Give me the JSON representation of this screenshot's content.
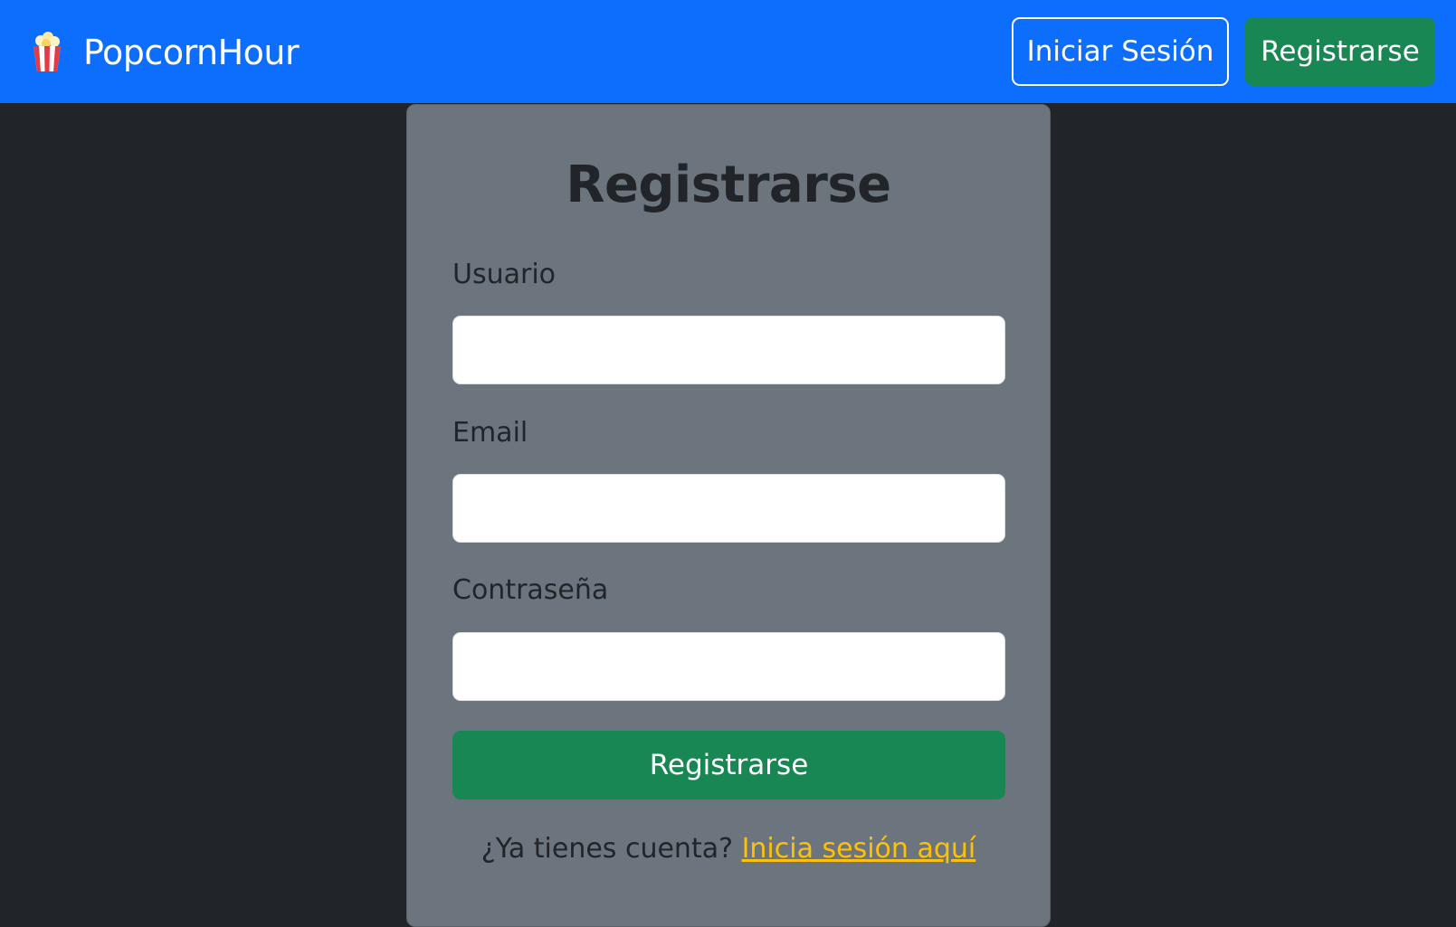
{
  "navbar": {
    "brand": {
      "icon": "popcorn-icon",
      "name": "PopcornHour"
    },
    "login_button": "Iniciar Sesión",
    "register_button": "Registrarse",
    "colors": {
      "background": "#0d6efd",
      "register_button": "#198754"
    }
  },
  "form": {
    "title": "Registrarse",
    "fields": [
      {
        "label": "Usuario",
        "value": "",
        "placeholder": ""
      },
      {
        "label": "Email",
        "value": "",
        "placeholder": ""
      },
      {
        "label": "Contraseña",
        "value": "",
        "placeholder": ""
      }
    ],
    "submit_label": "Registrarse",
    "footer": {
      "prompt": "¿Ya tienes cuenta?",
      "link": "Inicia sesión aquí"
    },
    "colors": {
      "card_background": "#6c757d",
      "page_background": "#212529",
      "submit": "#198754",
      "link": "#ffc107"
    }
  }
}
